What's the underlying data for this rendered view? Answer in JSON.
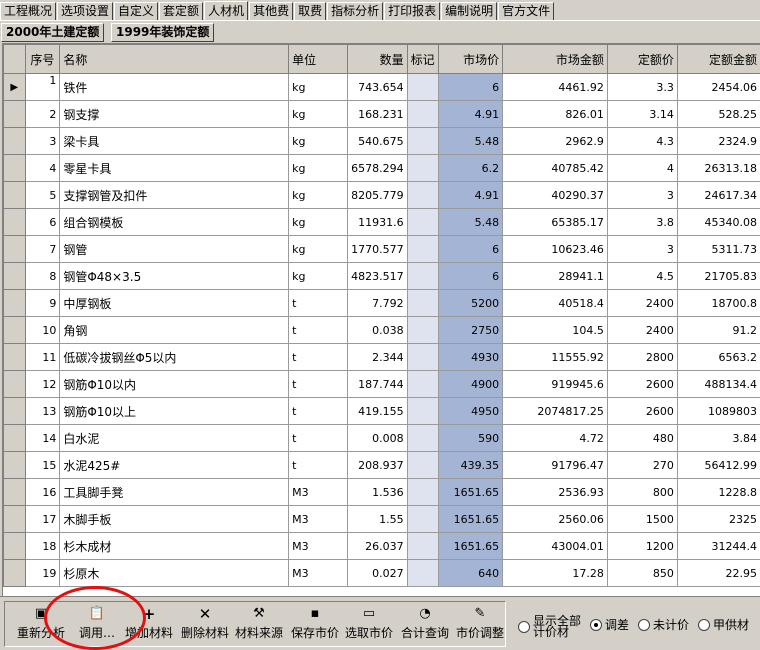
{
  "tabs": [
    "工程概况",
    "选项设置",
    "自定义",
    "套定额",
    "人材机",
    "其他费",
    "取费",
    "指标分析",
    "打印报表",
    "编制说明",
    "官方文件"
  ],
  "active_tab": "人材机",
  "subtabs": [
    "2000年土建定额",
    "1999年装饰定额"
  ],
  "table": {
    "headers": [
      "序号",
      "名称",
      "单位",
      "数量",
      "标记",
      "市场价",
      "市场金额",
      "定额价",
      "定额金额"
    ],
    "rows": [
      [
        "1",
        "铁件",
        "kg",
        "743.654",
        "",
        "6",
        "4461.92",
        "3.3",
        "2454.06"
      ],
      [
        "2",
        "钢支撑",
        "kg",
        "168.231",
        "",
        "4.91",
        "826.01",
        "3.14",
        "528.25"
      ],
      [
        "3",
        "梁卡具",
        "kg",
        "540.675",
        "",
        "5.48",
        "2962.9",
        "4.3",
        "2324.9"
      ],
      [
        "4",
        "零星卡具",
        "kg",
        "6578.294",
        "",
        "6.2",
        "40785.42",
        "4",
        "26313.18"
      ],
      [
        "5",
        "支撑钢管及扣件",
        "kg",
        "8205.779",
        "",
        "4.91",
        "40290.37",
        "3",
        "24617.34"
      ],
      [
        "6",
        "组合钢模板",
        "kg",
        "11931.6",
        "",
        "5.48",
        "65385.17",
        "3.8",
        "45340.08"
      ],
      [
        "7",
        "钢管",
        "kg",
        "1770.577",
        "",
        "6",
        "10623.46",
        "3",
        "5311.73"
      ],
      [
        "8",
        "钢管Φ48×3.5",
        "kg",
        "4823.517",
        "",
        "6",
        "28941.1",
        "4.5",
        "21705.83"
      ],
      [
        "9",
        "中厚钢板",
        "t",
        "7.792",
        "",
        "5200",
        "40518.4",
        "2400",
        "18700.8"
      ],
      [
        "10",
        "角钢",
        "t",
        "0.038",
        "",
        "2750",
        "104.5",
        "2400",
        "91.2"
      ],
      [
        "11",
        "低碳冷拔钢丝Φ5以内",
        "t",
        "2.344",
        "",
        "4930",
        "11555.92",
        "2800",
        "6563.2"
      ],
      [
        "12",
        "钢筋Φ10以内",
        "t",
        "187.744",
        "",
        "4900",
        "919945.6",
        "2600",
        "488134.4"
      ],
      [
        "13",
        "钢筋Φ10以上",
        "t",
        "419.155",
        "",
        "4950",
        "2074817.25",
        "2600",
        "1089803"
      ],
      [
        "14",
        "白水泥",
        "t",
        "0.008",
        "",
        "590",
        "4.72",
        "480",
        "3.84"
      ],
      [
        "15",
        "水泥425#",
        "t",
        "208.937",
        "",
        "439.35",
        "91796.47",
        "270",
        "56412.99"
      ],
      [
        "16",
        "工具脚手凳",
        "M3",
        "1.536",
        "",
        "1651.65",
        "2536.93",
        "800",
        "1228.8"
      ],
      [
        "17",
        "木脚手板",
        "M3",
        "1.55",
        "",
        "1651.65",
        "2560.06",
        "1500",
        "2325"
      ],
      [
        "18",
        "杉木成材",
        "M3",
        "26.037",
        "",
        "1651.65",
        "43004.01",
        "1200",
        "31244.4"
      ],
      [
        "19",
        "杉原木",
        "M3",
        "0.027",
        "",
        "640",
        "17.28",
        "850",
        "22.95"
      ]
    ]
  },
  "toolbar": {
    "buttons": [
      {
        "label": "重新分析",
        "icon": "analyze-icon"
      },
      {
        "label": "调用…",
        "icon": "paste-icon"
      },
      {
        "label": "增加材料",
        "icon": "plus-icon"
      },
      {
        "label": "删除材料",
        "icon": "delete-icon"
      },
      {
        "label": "材料来源",
        "icon": "source-icon"
      },
      {
        "label": "保存市价",
        "icon": "save-icon"
      },
      {
        "label": "选取市价",
        "icon": "open-folder-icon"
      },
      {
        "label": "合计查询",
        "icon": "query-icon"
      },
      {
        "label": "市价调整",
        "icon": "adjust-icon"
      }
    ],
    "options": [
      {
        "label": "显示全部计价材",
        "checked": false
      },
      {
        "label": "调差",
        "checked": true
      },
      {
        "label": "未计价",
        "checked": false
      },
      {
        "label": "甲供材",
        "checked": false
      }
    ]
  },
  "colors": {
    "market_column": "#a4b4d4",
    "flag_column": "#dfe3ef",
    "highlight_circle": "#e21010"
  }
}
